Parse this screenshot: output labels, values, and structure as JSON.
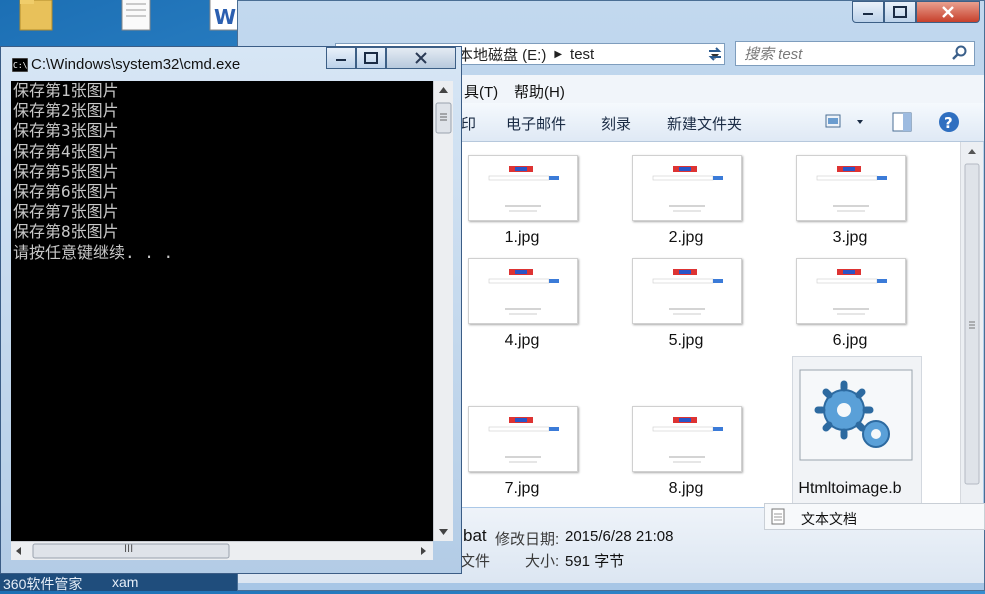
{
  "colors": {
    "console_bg": "#000000",
    "console_text": "#c8c8c8",
    "explorer_chrome": "#b5cfea",
    "close_button": "#c7402c"
  },
  "desktop": {
    "icons": [
      "folder-icon",
      "document-icon",
      "word-icon"
    ]
  },
  "explorer": {
    "address": {
      "drive": "本地磁盘 (E:)",
      "folder": "test",
      "separator": "▶"
    },
    "search": {
      "placeholder": "搜索 test"
    },
    "menu": {
      "tools": "具(T)",
      "help": "帮助(H)"
    },
    "toolbar": {
      "partial": "印",
      "email": "电子邮件",
      "burn": "刻录",
      "new_folder": "新建文件夹"
    },
    "files": [
      {
        "name": "1.jpg"
      },
      {
        "name": "2.jpg"
      },
      {
        "name": "3.jpg"
      },
      {
        "name": "4.jpg"
      },
      {
        "name": "5.jpg"
      },
      {
        "name": "6.jpg"
      },
      {
        "name": "7.jpg"
      },
      {
        "name": "8.jpg"
      },
      {
        "name": "Htmltoimage.b"
      }
    ],
    "details": {
      "name_partial": "bat",
      "modified_label": "修改日期:",
      "modified_value": "2015/6/28 21:08",
      "type_partial": "文件",
      "size_label": "大小:",
      "size_value": "591 字节"
    }
  },
  "context_menu": {
    "item": "文本文档"
  },
  "cmd": {
    "title": "C:\\Windows\\system32\\cmd.exe",
    "lines": [
      "保存第1张图片",
      "保存第2张图片",
      "保存第3张图片",
      "保存第4张图片",
      "保存第5张图片",
      "保存第6张图片",
      "保存第7张图片",
      "保存第8张图片",
      "请按任意键继续. . ."
    ],
    "hscroll_grip": "III"
  },
  "taskbar": {
    "item1": "360软件管家",
    "item2": "xam"
  }
}
